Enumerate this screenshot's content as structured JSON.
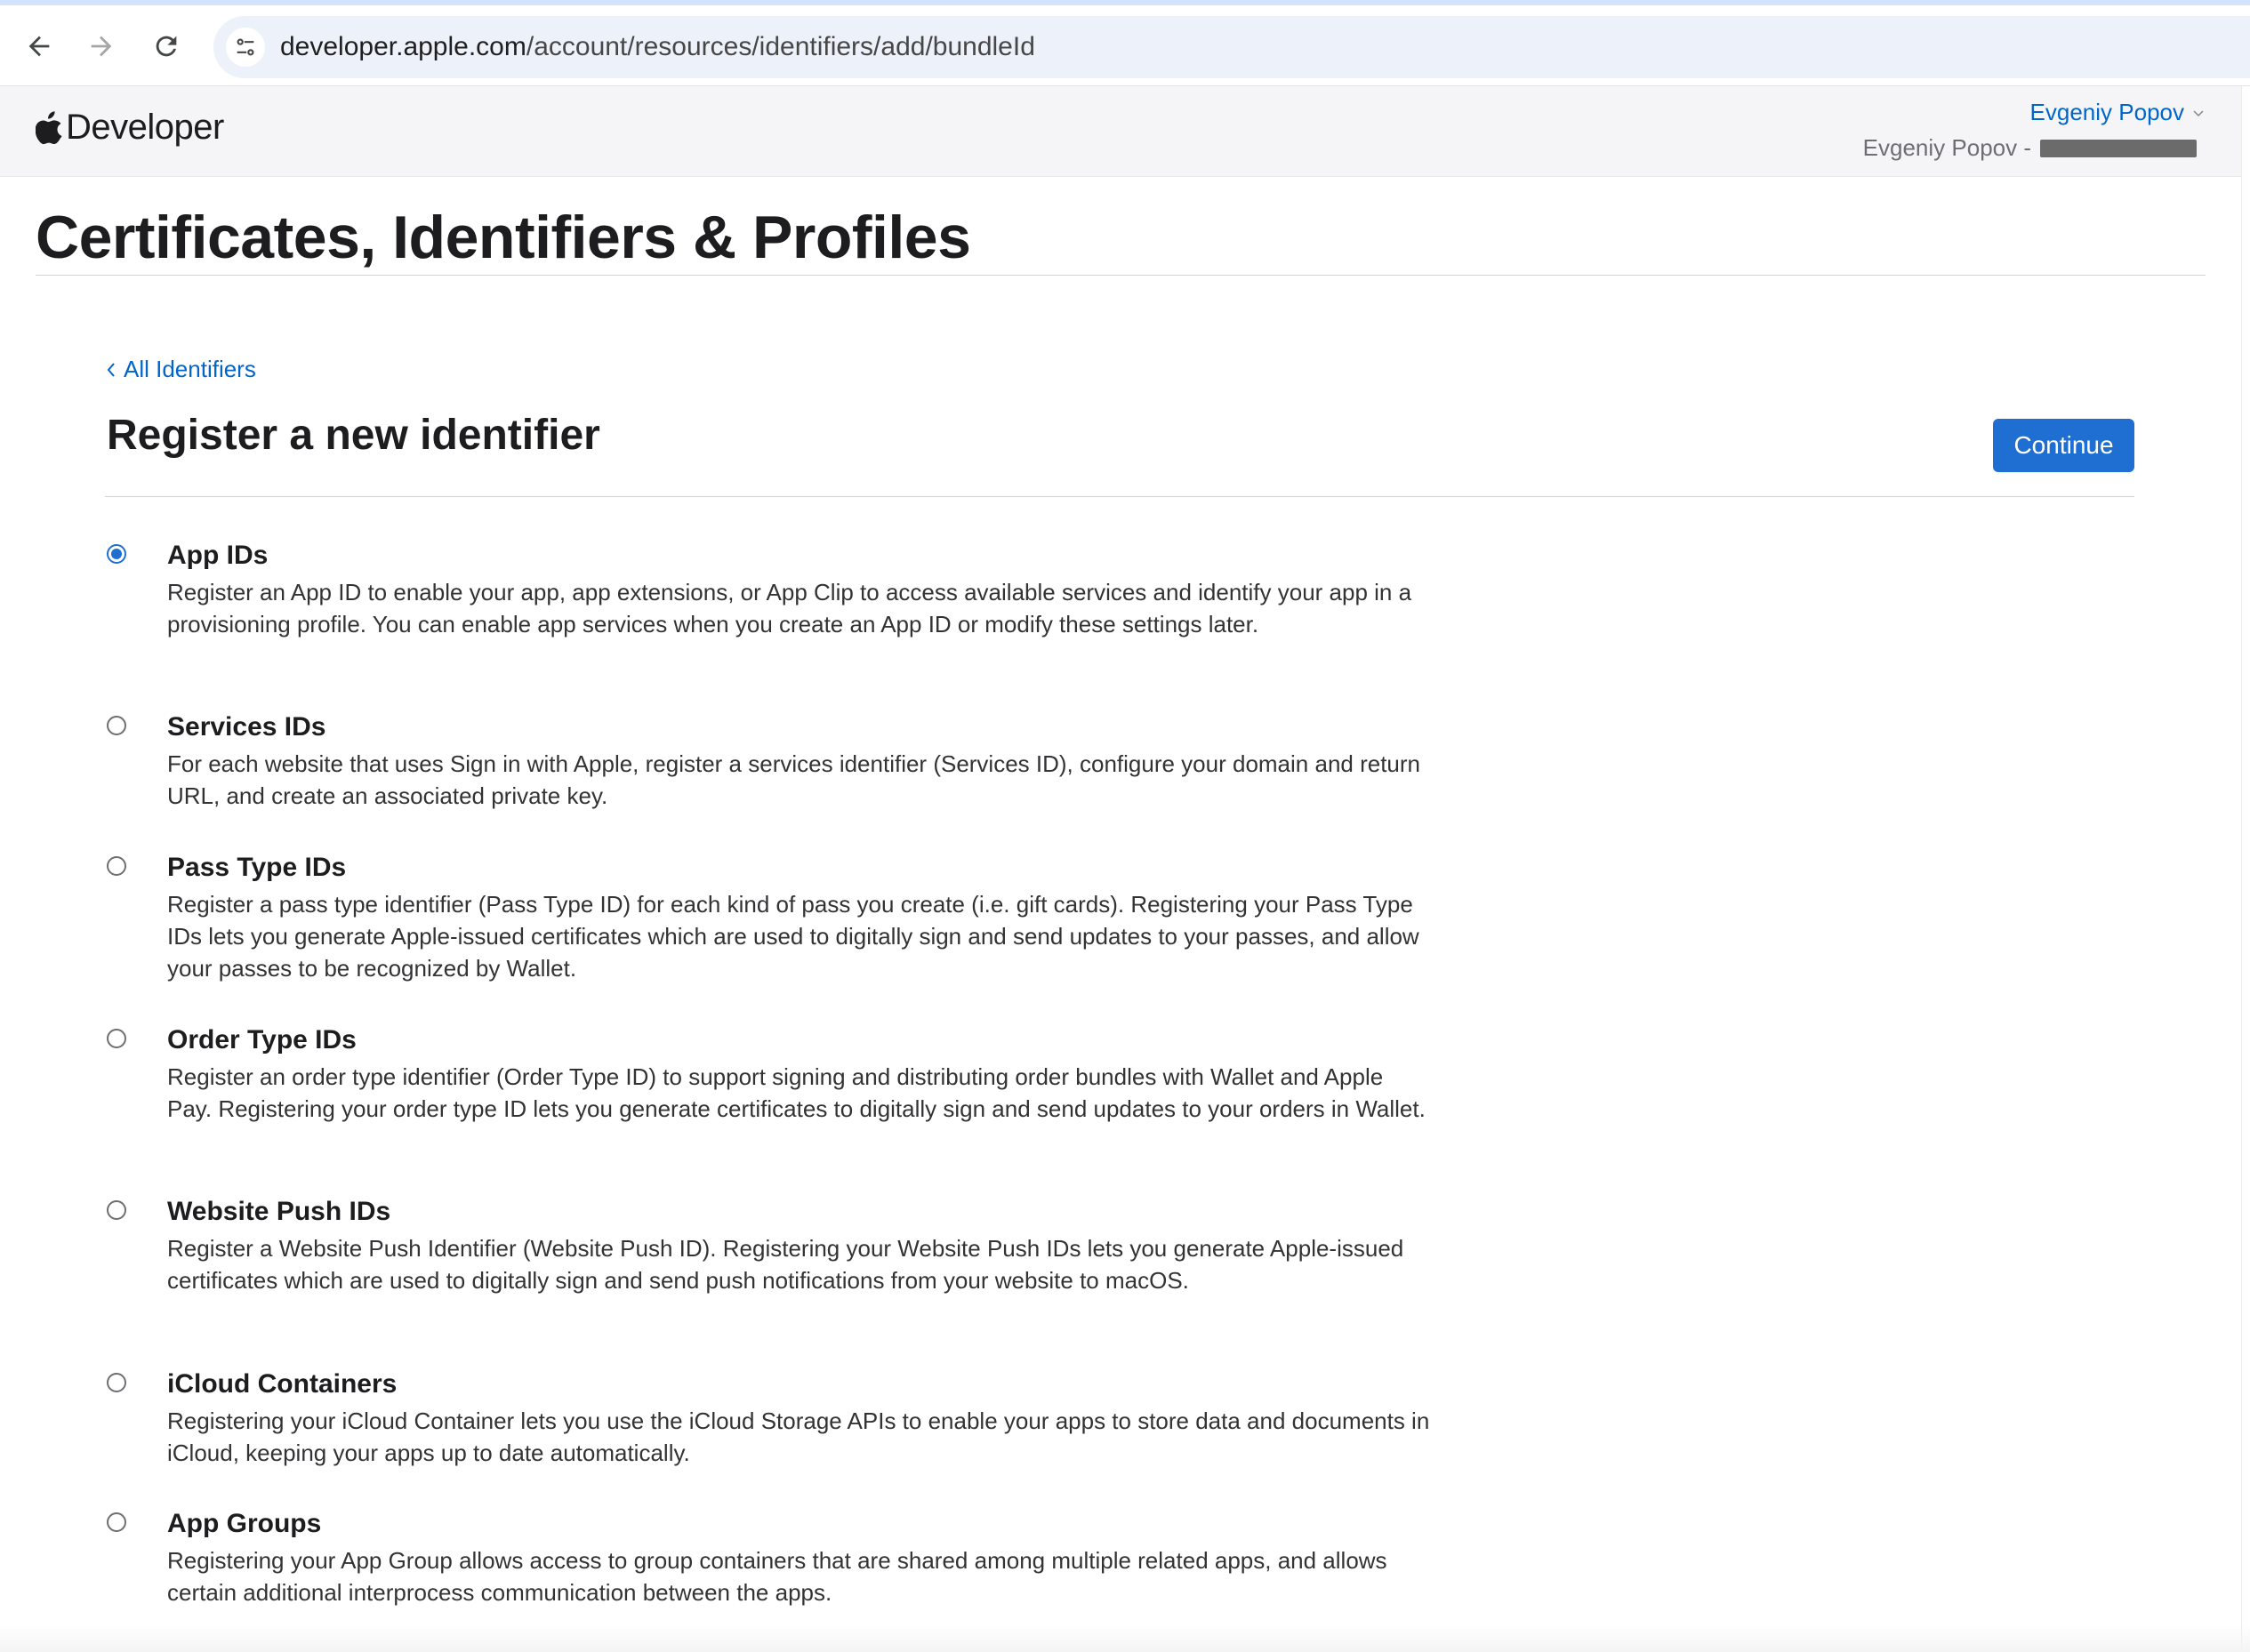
{
  "browser": {
    "url_host": "developer.apple.com",
    "url_path": "/account/resources/identifiers/add/bundleId",
    "icons": [
      "back-arrow-icon",
      "forward-arrow-icon",
      "reload-icon",
      "site-info-icon"
    ]
  },
  "header": {
    "logo_text": "Developer",
    "account_name": "Evgeniy Popov",
    "team_label": "Evgeniy Popov -"
  },
  "page": {
    "title": "Certificates, Identifiers & Profiles"
  },
  "section": {
    "back_link": "All Identifiers",
    "title": "Register a new identifier",
    "continue_label": "Continue"
  },
  "options": [
    {
      "label": "App IDs",
      "description": "Register an App ID to enable your app, app extensions, or App Clip to access available services and identify your app in a provisioning profile. You can enable app services when you create an App ID or modify these settings later.",
      "selected": true
    },
    {
      "label": "Services IDs",
      "description": "For each website that uses Sign in with Apple, register a services identifier (Services ID), configure your domain and return URL, and create an associated private key.",
      "selected": false
    },
    {
      "label": "Pass Type IDs",
      "description": "Register a pass type identifier (Pass Type ID) for each kind of pass you create (i.e. gift cards). Registering your Pass Type IDs lets you generate Apple-issued certificates which are used to digitally sign and send updates to your passes, and allow your passes to be recognized by Wallet.",
      "selected": false
    },
    {
      "label": "Order Type IDs",
      "description": "Register an order type identifier (Order Type ID) to support signing and distributing order bundles with Wallet and Apple Pay. Registering your order type ID lets you generate certificates to digitally sign and send updates to your orders in Wallet.",
      "selected": false
    },
    {
      "label": "Website Push IDs",
      "description": "Register a Website Push Identifier (Website Push ID). Registering your Website Push IDs lets you generate Apple-issued certificates which are used to digitally sign and send push notifications from your website to macOS.",
      "selected": false
    },
    {
      "label": "iCloud Containers",
      "description": "Registering your iCloud Container lets you use the iCloud Storage APIs to enable your apps to store data and documents in iCloud, keeping your apps up to date automatically.",
      "selected": false
    },
    {
      "label": "App Groups",
      "description": "Registering your App Group allows access to group containers that are shared among multiple related apps, and allows certain additional interprocess communication between the apps.",
      "selected": false
    }
  ],
  "colors": {
    "accent": "#1f6fd2",
    "link": "#0066cc",
    "text": "#1d1d1f",
    "header_bg": "#f5f5f7"
  }
}
